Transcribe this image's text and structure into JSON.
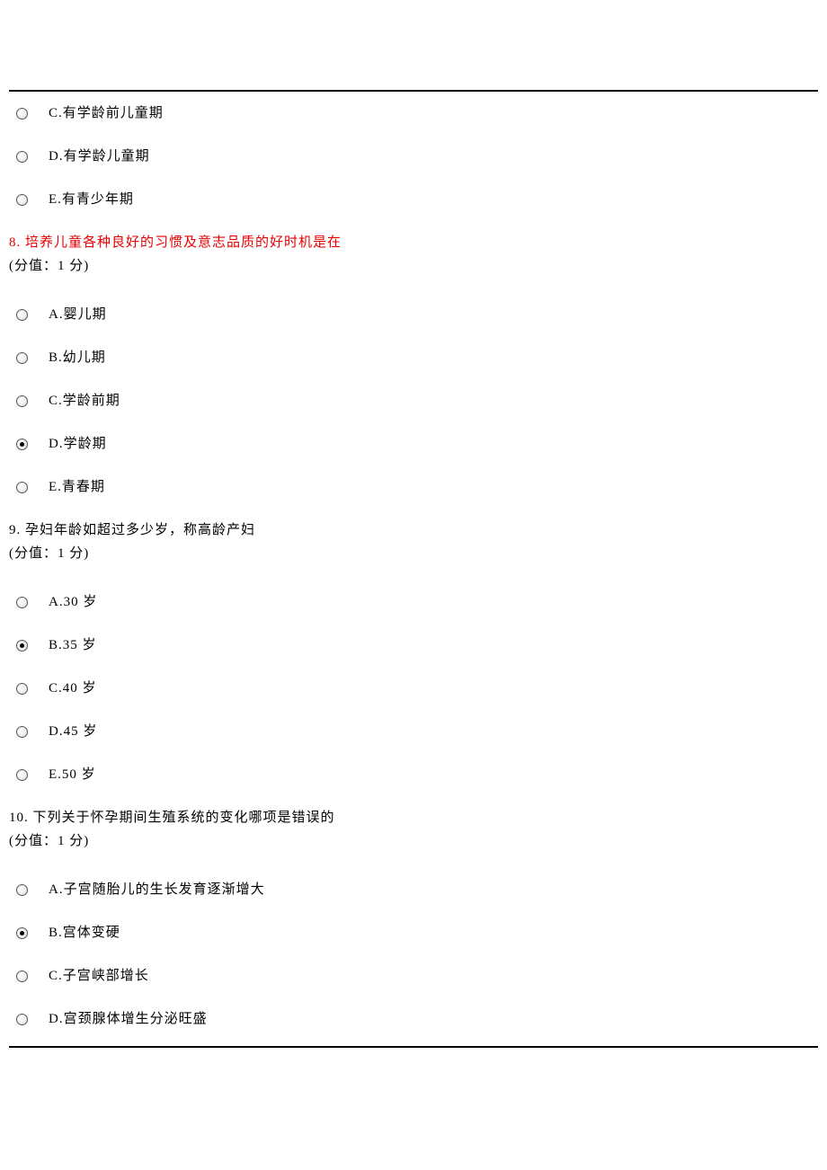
{
  "partial_options": {
    "c": "C.有学龄前儿童期",
    "d": "D.有学龄儿童期",
    "e": "E.有青少年期"
  },
  "q8": {
    "num": "8.",
    "title": "培养儿童各种良好的习惯及意志品质的好时机是在",
    "points": "(分值：1 分)",
    "opts": {
      "a": "A.婴儿期",
      "b": "B.幼儿期",
      "c": "C.学龄前期",
      "d": "D.学龄期",
      "e": "E.青春期"
    }
  },
  "q9": {
    "num": "9.",
    "title": "孕妇年龄如超过多少岁，称高龄产妇",
    "points": "(分值：1 分)",
    "opts": {
      "a": "A.30 岁",
      "b": "B.35 岁",
      "c": "C.40 岁",
      "d": "D.45 岁",
      "e": "E.50 岁"
    }
  },
  "q10": {
    "num": "10.",
    "title": "下列关于怀孕期间生殖系统的变化哪项是错误的",
    "points": "(分值：1 分)",
    "opts": {
      "a": "A.子宫随胎儿的生长发育逐渐增大",
      "b": "B.宫体变硬",
      "c": "C.子宫峡部增长",
      "d": "D.宫颈腺体增生分泌旺盛"
    }
  }
}
